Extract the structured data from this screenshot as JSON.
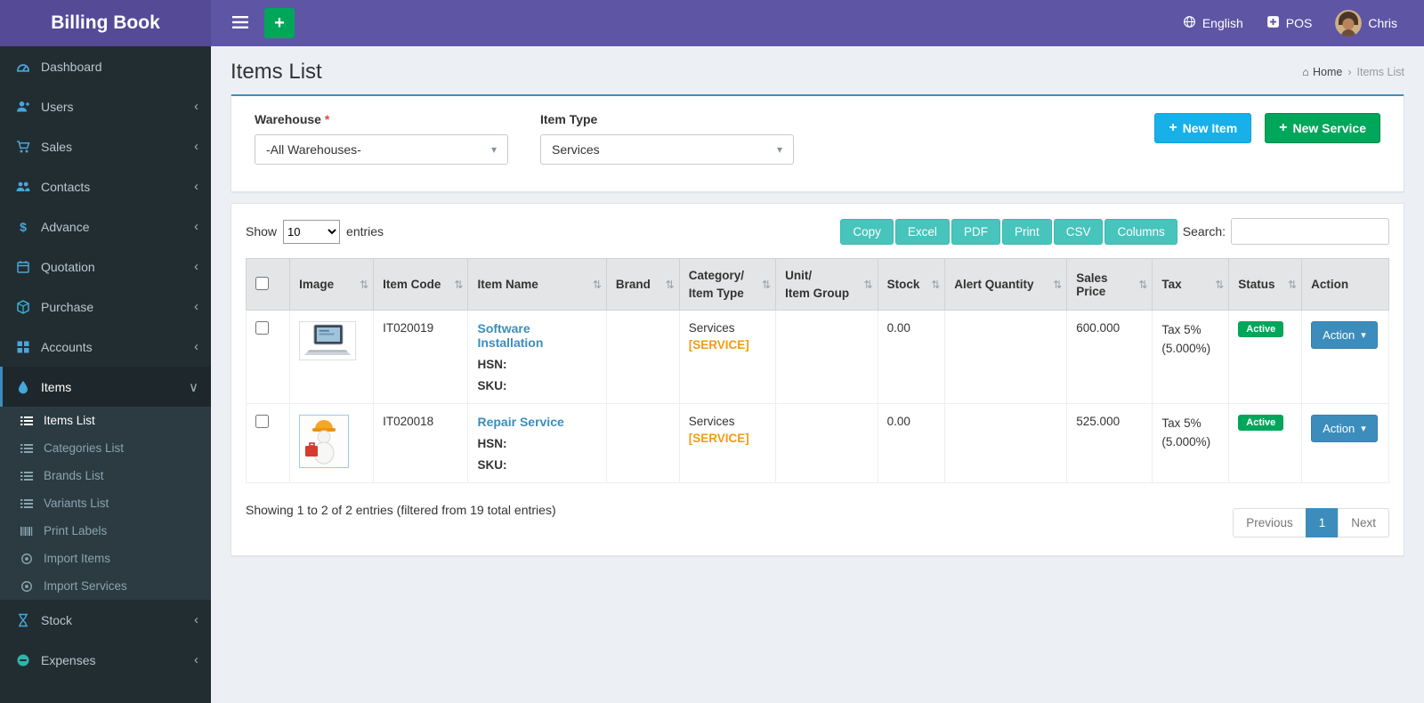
{
  "colors": {
    "topbar": "#5f55a5",
    "logo_bg": "#544a96",
    "sidebar": "#222d32",
    "primary": "#3c8dbc",
    "success": "#00a65a",
    "info": "#17b0e9",
    "export_teal": "#47c4bc",
    "tag_orange": "#f39c12",
    "required_red": "#dd4b39"
  },
  "icons": {
    "plus": "+",
    "caret_down": "▾",
    "sort": "⇅",
    "home": "⌂",
    "chevron_collapsed": "‹",
    "chevron_expanded": "∨",
    "breadcrumb_separator": "›"
  },
  "app": {
    "title": "Billing Book"
  },
  "topbar": {
    "language": "English",
    "pos": "POS",
    "user": "Chris"
  },
  "sidebar": {
    "items": [
      {
        "label": "Dashboard"
      },
      {
        "label": "Users"
      },
      {
        "label": "Sales"
      },
      {
        "label": "Contacts"
      },
      {
        "label": "Advance"
      },
      {
        "label": "Quotation"
      },
      {
        "label": "Purchase"
      },
      {
        "label": "Accounts"
      },
      {
        "label": "Items"
      },
      {
        "label": "Stock"
      },
      {
        "label": "Expenses"
      }
    ],
    "items_submenu": [
      {
        "label": "Items List"
      },
      {
        "label": "Categories List"
      },
      {
        "label": "Brands List"
      },
      {
        "label": "Variants List"
      },
      {
        "label": "Print Labels"
      },
      {
        "label": "Import Items"
      },
      {
        "label": "Import Services"
      }
    ]
  },
  "page": {
    "title": "Items List",
    "breadcrumb": {
      "home": "Home",
      "current": "Items List"
    }
  },
  "filters": {
    "warehouse_label": "Warehouse",
    "required_mark": "*",
    "warehouse_value": "-All Warehouses-",
    "item_type_label": "Item Type",
    "item_type_value": "Services",
    "new_item_label": "New Item",
    "new_service_label": "New Service"
  },
  "table": {
    "show_label": "Show",
    "length_value": "10",
    "entries_label": "entries",
    "export_buttons": [
      "Copy",
      "Excel",
      "PDF",
      "Print",
      "CSV",
      "Columns"
    ],
    "search_label": "Search:",
    "headers": {
      "image": "Image",
      "item_code": "Item Code",
      "item_name": "Item Name",
      "brand": "Brand",
      "category_line1": "Category/",
      "category_line2": "Item Type",
      "unit_line1": "Unit/",
      "unit_line2": "Item Group",
      "stock": "Stock",
      "alert_quantity": "Alert Quantity",
      "sales_price": "Sales Price",
      "tax": "Tax",
      "status": "Status",
      "action": "Action"
    },
    "rows": [
      {
        "image": "laptop-photo",
        "item_code": "IT020019",
        "item_name": "Software Installation",
        "hsn_label": "HSN:",
        "sku_label": "SKU:",
        "brand": "",
        "category": "Services",
        "category_tag": "[SERVICE]",
        "unit_group": "",
        "stock": "0.00",
        "alert_quantity": "",
        "sales_price": "600.000",
        "tax_line1": "Tax 5%",
        "tax_line2": "(5.000%)",
        "status": "Active",
        "action_label": "Action"
      },
      {
        "image": "repair-figure-photo",
        "item_code": "IT020018",
        "item_name": "Repair Service",
        "hsn_label": "HSN:",
        "sku_label": "SKU:",
        "brand": "",
        "category": "Services",
        "category_tag": "[SERVICE]",
        "unit_group": "",
        "stock": "0.00",
        "alert_quantity": "",
        "sales_price": "525.000",
        "tax_line1": "Tax 5%",
        "tax_line2": "(5.000%)",
        "status": "Active",
        "action_label": "Action"
      }
    ],
    "info": "Showing 1 to 2 of 2 entries (filtered from 19 total entries)",
    "pagination": {
      "previous": "Previous",
      "page": "1",
      "next": "Next"
    }
  }
}
